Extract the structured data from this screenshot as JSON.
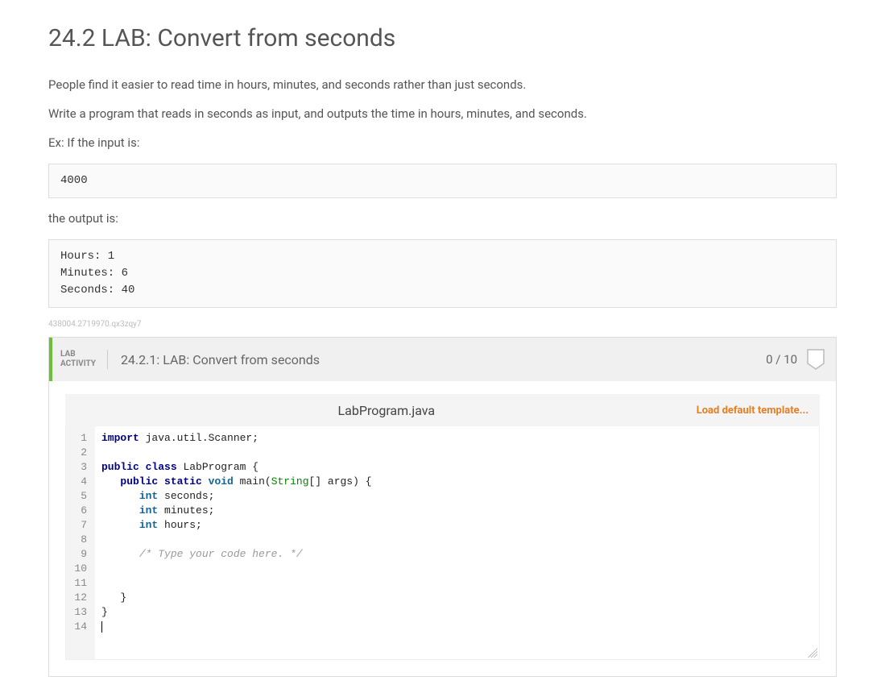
{
  "title": "24.2 LAB: Convert from seconds",
  "description": {
    "p1": "People find it easier to read time in hours, minutes, and seconds rather than just seconds.",
    "p2": "Write a program that reads in seconds as input, and outputs the time in hours, minutes, and seconds.",
    "ex_label": "Ex: If the input is:",
    "input_example": "4000",
    "output_label": "the output is:",
    "output_example": "Hours: 1\nMinutes: 6\nSeconds: 40"
  },
  "tiny_id": "438004.2719970.qx3zqy7",
  "lab": {
    "tag_line1": "LAB",
    "tag_line2": "ACTIVITY",
    "title": "24.2.1: LAB: Convert from seconds",
    "score": "0 / 10"
  },
  "editor": {
    "filename": "LabProgram.java",
    "load_template": "Load default template...",
    "line_count": 14,
    "code": {
      "l1": {
        "pre": "",
        "tokens": [
          {
            "t": "import",
            "c": "kw"
          },
          {
            "t": " java.util.Scanner;",
            "c": ""
          }
        ]
      },
      "l2": {
        "pre": "",
        "tokens": []
      },
      "l3": {
        "pre": "",
        "tokens": [
          {
            "t": "public",
            "c": "kw"
          },
          {
            "t": " ",
            "c": ""
          },
          {
            "t": "class",
            "c": "kw"
          },
          {
            "t": " ",
            "c": ""
          },
          {
            "t": "LabProgram",
            "c": "cls"
          },
          {
            "t": " {",
            "c": ""
          }
        ]
      },
      "l4": {
        "pre": "   ",
        "tokens": [
          {
            "t": "public",
            "c": "kw"
          },
          {
            "t": " ",
            "c": ""
          },
          {
            "t": "static",
            "c": "kw"
          },
          {
            "t": " ",
            "c": ""
          },
          {
            "t": "void",
            "c": "type"
          },
          {
            "t": " main(",
            "c": ""
          },
          {
            "t": "String",
            "c": "str"
          },
          {
            "t": "[] args) {",
            "c": ""
          }
        ]
      },
      "l5": {
        "pre": "      ",
        "tokens": [
          {
            "t": "int",
            "c": "type"
          },
          {
            "t": " seconds;",
            "c": ""
          }
        ]
      },
      "l6": {
        "pre": "      ",
        "tokens": [
          {
            "t": "int",
            "c": "type"
          },
          {
            "t": " minutes;",
            "c": ""
          }
        ]
      },
      "l7": {
        "pre": "      ",
        "tokens": [
          {
            "t": "int",
            "c": "type"
          },
          {
            "t": " hours;",
            "c": ""
          }
        ]
      },
      "l8": {
        "pre": "",
        "tokens": []
      },
      "l9": {
        "pre": "      ",
        "tokens": [
          {
            "t": "/* Type your code here. */",
            "c": "com"
          }
        ]
      },
      "l10": {
        "pre": "",
        "tokens": []
      },
      "l11": {
        "pre": "",
        "tokens": []
      },
      "l12": {
        "pre": "   ",
        "tokens": [
          {
            "t": "}",
            "c": ""
          }
        ]
      },
      "l13": {
        "pre": "",
        "tokens": [
          {
            "t": "}",
            "c": ""
          }
        ]
      },
      "l14": {
        "pre": "",
        "tokens": []
      }
    }
  }
}
